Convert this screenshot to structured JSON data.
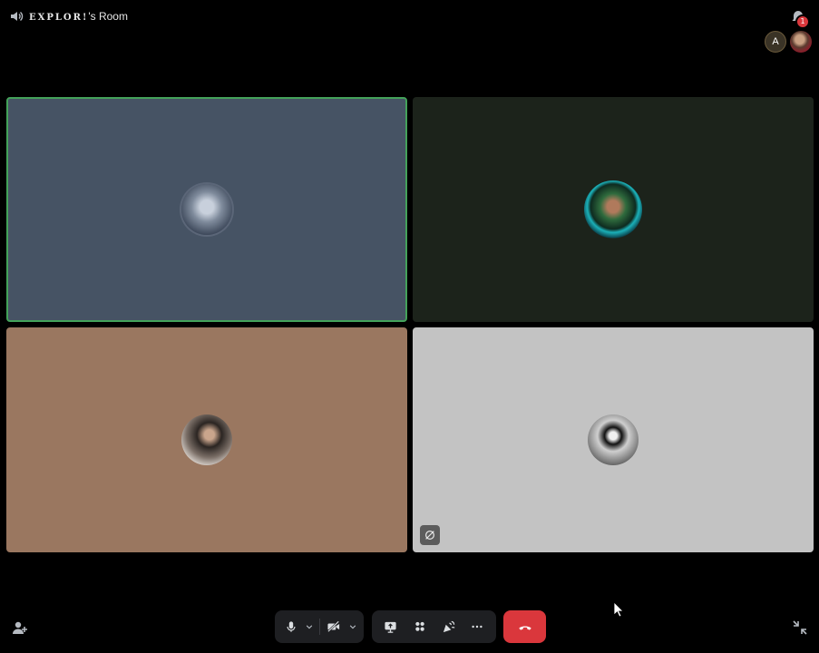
{
  "header": {
    "room_brand": "EXPLOR!",
    "room_suffix": "'s Room",
    "icons": {
      "speaker": "speaker-icon",
      "inbox": "inbox-icon"
    },
    "notification_count": "1"
  },
  "participants_preview": [
    {
      "initial": "A"
    },
    {
      "initial": ""
    }
  ],
  "tiles": [
    {
      "id": "participant-1",
      "speaking": true,
      "bg": "#465364"
    },
    {
      "id": "participant-2",
      "speaking": false,
      "bg": "#1c231b"
    },
    {
      "id": "participant-3",
      "speaking": false,
      "bg": "#9a7760"
    },
    {
      "id": "participant-4",
      "speaking": false,
      "bg": "#c3c3c3",
      "indicator": "noise-suppression-icon"
    }
  ],
  "controls": {
    "mic": "microphone-icon",
    "camera": "camera-off-icon",
    "share_screen": "screen-share-icon",
    "activities": "activities-icon",
    "soundboard": "soundboard-icon",
    "more": "more-icon",
    "hangup": "hang-up-icon",
    "invite": "invite-icon",
    "collapse": "collapse-icon"
  },
  "colors": {
    "speaking_border": "#44a25a",
    "hangup": "#da373c",
    "control_bg": "#1e1f22"
  }
}
